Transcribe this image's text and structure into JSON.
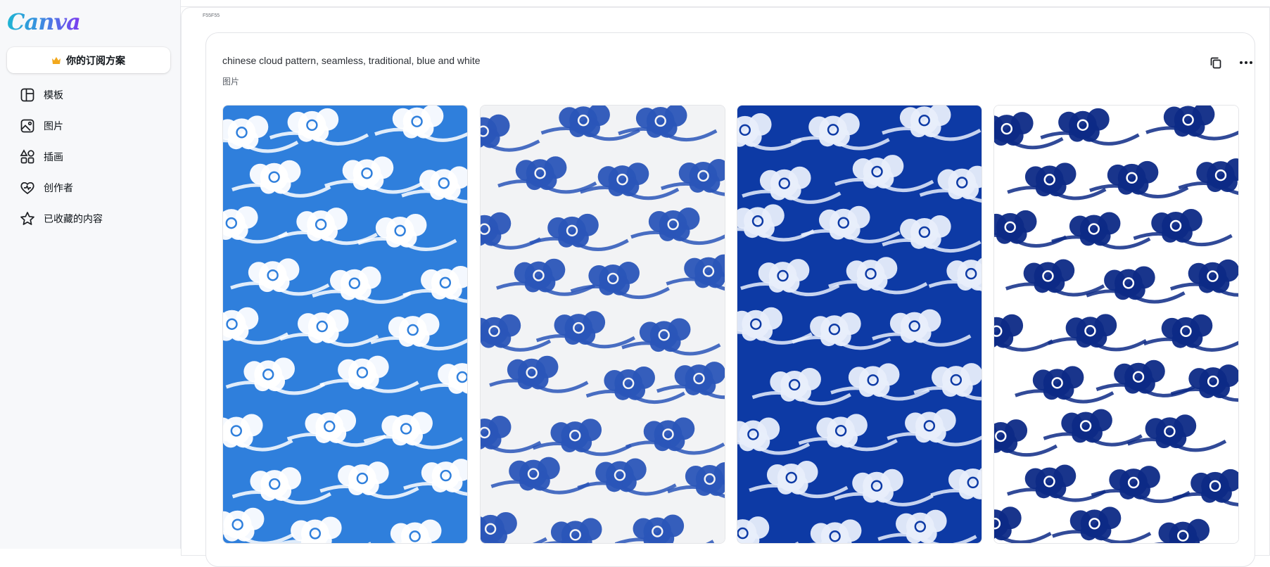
{
  "app": {
    "logo": "Canva"
  },
  "sidebar": {
    "plan_label": "你的订阅方案",
    "items": [
      {
        "label": "模板",
        "icon": "template-icon"
      },
      {
        "label": "图片",
        "icon": "image-icon"
      },
      {
        "label": "插画",
        "icon": "shapes-icon"
      },
      {
        "label": "创作者",
        "icon": "creator-heart-icon"
      },
      {
        "label": "已收藏的内容",
        "icon": "star-icon"
      }
    ]
  },
  "main": {
    "tiny_label": "F55F55",
    "prompt": "chinese cloud pattern, seamless, traditional, blue and white",
    "kind": "图片",
    "results": [
      {
        "style": "white-clouds-on-bright-blue",
        "bg": "#2f7fdc",
        "fg": "#ffffff"
      },
      {
        "style": "blue-clouds-on-white",
        "bg": "#f2f3f5",
        "fg": "#2a55b8"
      },
      {
        "style": "light-clouds-on-deep-blue",
        "bg": "#0d3aa5",
        "fg": "#e8eefb"
      },
      {
        "style": "navy-clouds-on-white",
        "bg": "#ffffff",
        "fg": "#0d2a86"
      }
    ]
  },
  "colors": {
    "accent": "#7d3cf0",
    "crown": "#f2a81d"
  }
}
